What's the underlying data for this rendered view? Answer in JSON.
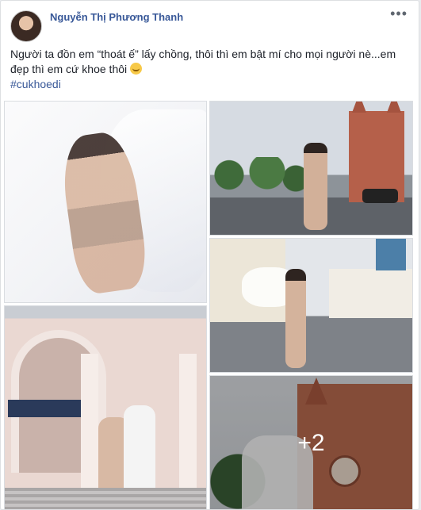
{
  "post": {
    "author": "Nguyễn Thị Phương Thanh",
    "more_label": "•••",
    "text_line1": "Người ta đồn em “thoát ế” lấy chồng, thôi thì em bật mí cho mọi người nè...em",
    "text_line2": "đẹp thì em cứ khoe thôi",
    "emoji": "smiling-face-icon",
    "hashtag": "#cukhoedi"
  },
  "photos": {
    "more_count": "+2"
  },
  "colors": {
    "link": "#385898",
    "text": "#1d2129",
    "background": "#e9ebee",
    "card": "#ffffff"
  }
}
